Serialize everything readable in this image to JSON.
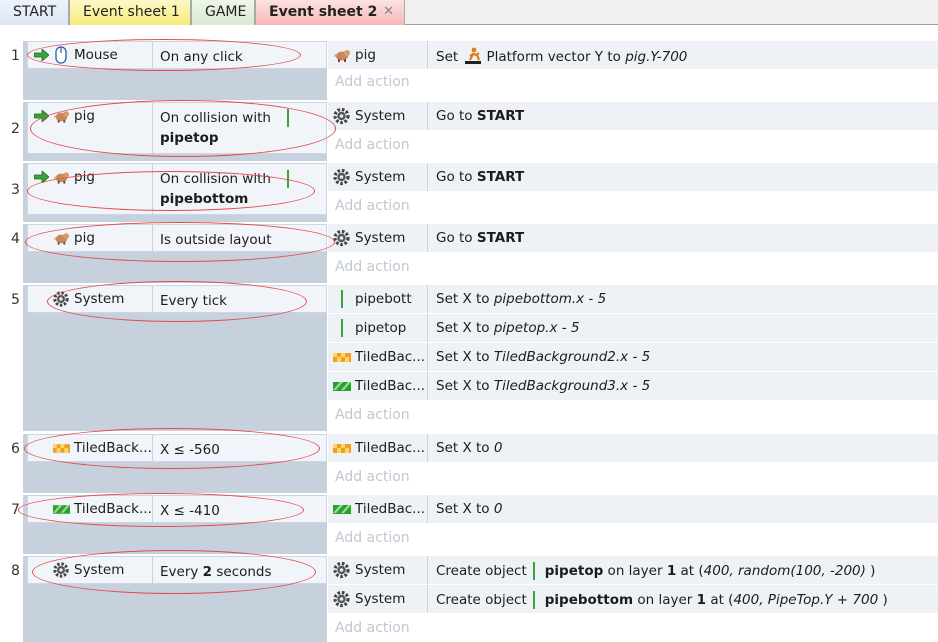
{
  "tabs": [
    {
      "label": "START"
    },
    {
      "label": "Event sheet 1"
    },
    {
      "label": "GAME"
    },
    {
      "label": "Event sheet 2",
      "close": "✕"
    }
  ],
  "add_action": "Add action",
  "events": [
    {
      "num": "1",
      "object": "Mouse",
      "condition": [
        "On any click"
      ],
      "actions": [
        {
          "object": "pig",
          "pre": "Set ",
          "platform": "Platform vector Y to ",
          "expr": "pig.Y-700"
        }
      ]
    },
    {
      "num": "2",
      "object": "pig",
      "condition": [
        "On collision with",
        "pipetop"
      ],
      "actions": [
        {
          "object": "System",
          "pre": "Go to ",
          "target": "START"
        }
      ]
    },
    {
      "num": "3",
      "object": "pig",
      "condition": [
        "On collision with",
        "pipebottom"
      ],
      "actions": [
        {
          "object": "System",
          "pre": "Go to ",
          "target": "START"
        }
      ]
    },
    {
      "num": "4",
      "object": "pig",
      "condition": [
        "Is outside layout"
      ],
      "actions": [
        {
          "object": "System",
          "pre": "Go to ",
          "target": "START"
        }
      ]
    },
    {
      "num": "5",
      "object": "System",
      "condition": [
        "Every tick"
      ],
      "actions": [
        {
          "object": "pipebott",
          "pre": "Set X to ",
          "expr": "pipebottom.x - 5"
        },
        {
          "object": "pipetop",
          "pre": "Set X to ",
          "expr": "pipetop.x - 5"
        },
        {
          "object": "TiledBac...",
          "pre": "Set X to ",
          "expr": "TiledBackground2.x - 5"
        },
        {
          "object": "TiledBac...",
          "pre": "Set X to ",
          "expr": "TiledBackground3.x - 5"
        }
      ]
    },
    {
      "num": "6",
      "object": "TiledBack...",
      "condition": [
        "X ≤ -560"
      ],
      "actions": [
        {
          "object": "TiledBac...",
          "pre": "Set X to ",
          "expr": "0"
        }
      ]
    },
    {
      "num": "7",
      "object": "TiledBack...",
      "condition": [
        "X ≤ -410"
      ],
      "actions": [
        {
          "object": "TiledBac...",
          "pre": "Set X to ",
          "expr": "0"
        }
      ]
    },
    {
      "num": "8",
      "object": "System",
      "condition": [
        "Every ",
        "2",
        " seconds"
      ],
      "actions": [
        {
          "object": "System",
          "pre": "Create object",
          "c1": "pipetop",
          "c2": " on layer ",
          "c3": "1",
          "c4": " at (",
          "c5": "400, random(100, -200)",
          "c6": " )"
        },
        {
          "object": "System",
          "pre": "Create object",
          "c1": "pipebottom",
          "c2": " on layer ",
          "c3": "1",
          "c4": " at (",
          "c5": "400, PipeTop.Y + 700",
          "c6": " )"
        }
      ]
    }
  ],
  "colors": {
    "highlight_ring": "#e24c4c",
    "condition_bg": "#f1f5fa",
    "action_bg": "#eef2f7",
    "event_gutter": "#c7d1dd"
  },
  "icons": {
    "trigger": "green-arrow-icon",
    "mouse": "mouse-icon",
    "pig": "pig-icon",
    "system": "gear-icon",
    "tiled_orange": "tiled-background-orange-icon",
    "tiled_green": "tiled-background-green-icon",
    "platform": "platform-behavior-icon"
  }
}
